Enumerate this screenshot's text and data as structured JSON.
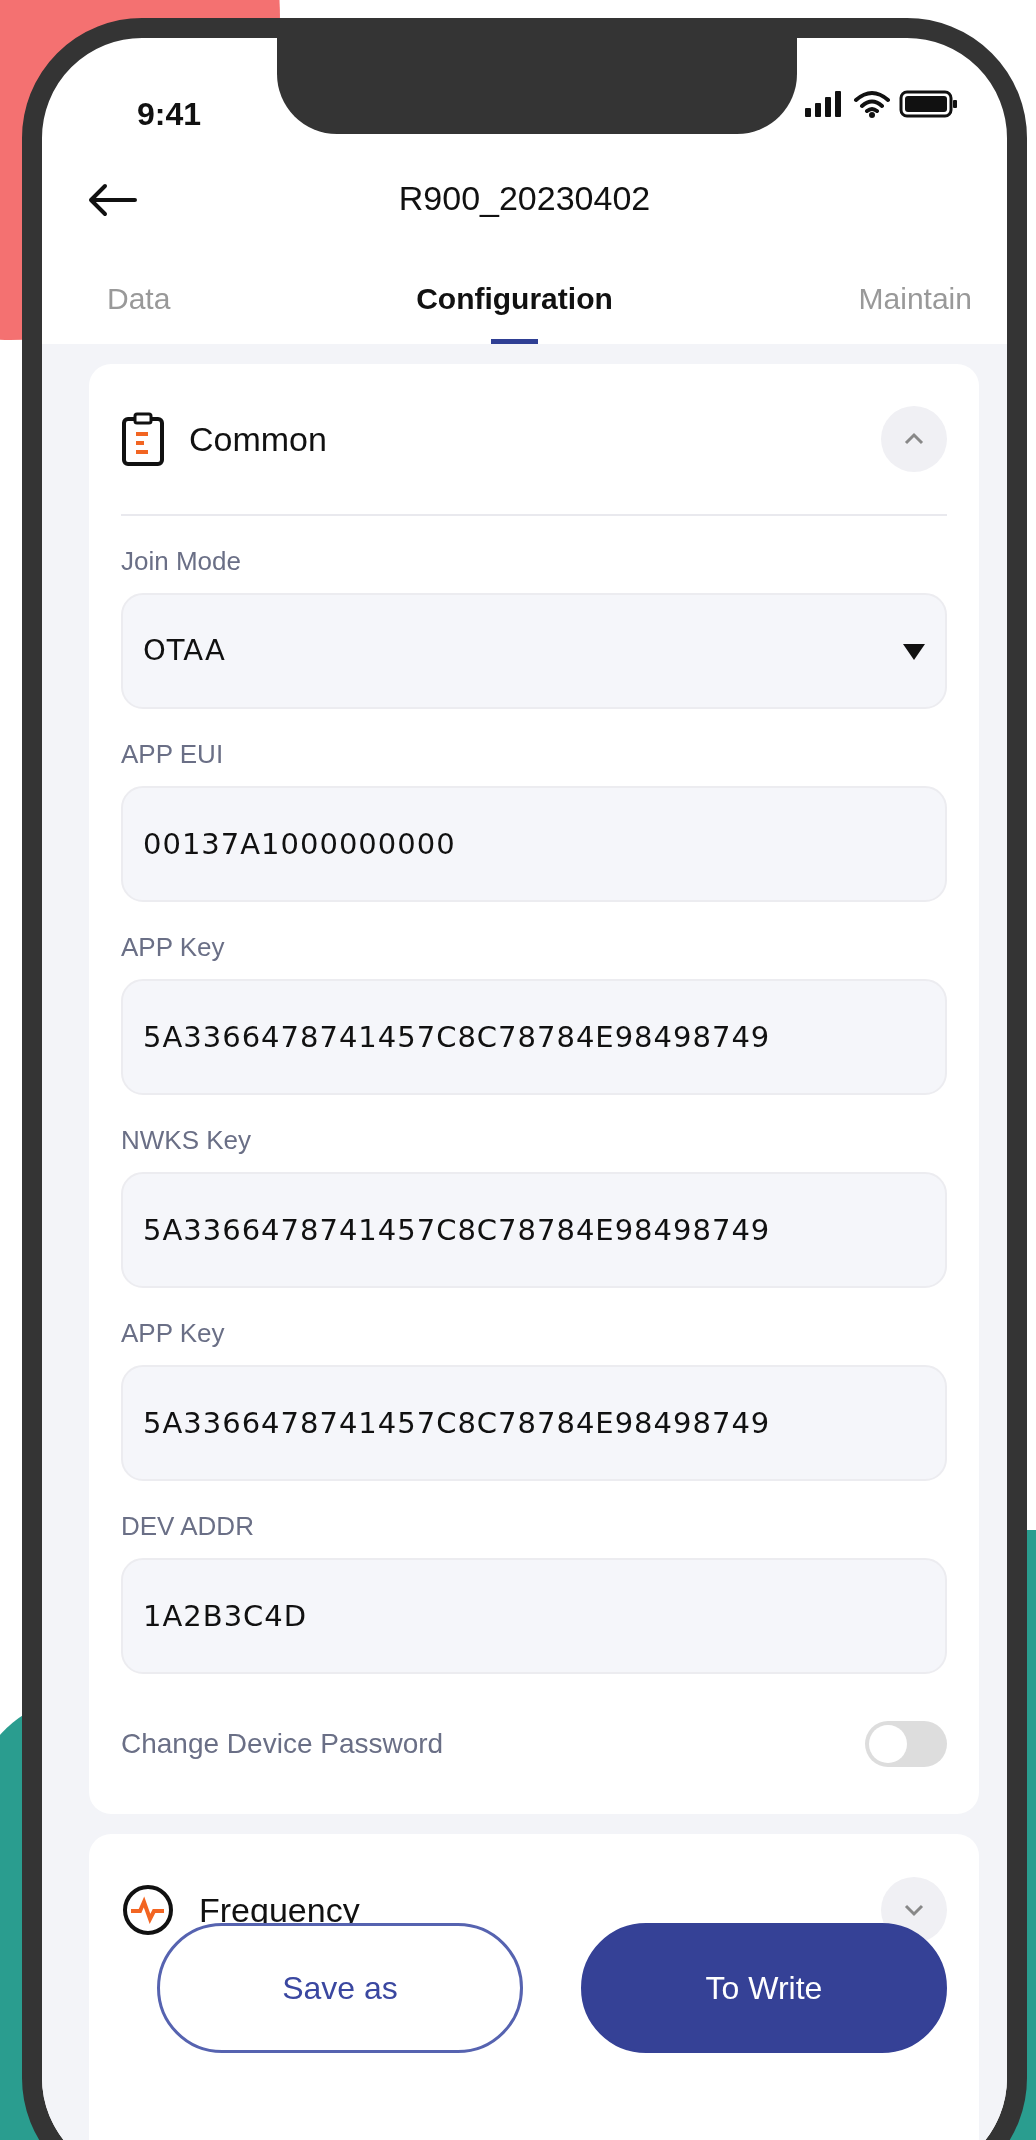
{
  "status_bar": {
    "time": "9:41"
  },
  "header": {
    "title": "R900_20230402"
  },
  "tabs": [
    {
      "label": "Data",
      "selected": false
    },
    {
      "label": "Configuration",
      "selected": true
    },
    {
      "label": "Maintain",
      "selected": false
    }
  ],
  "sections": [
    {
      "title": "Common",
      "expanded": true,
      "fields": [
        {
          "kind": "select",
          "label": "Join Mode",
          "value": "OTAA"
        },
        {
          "kind": "text",
          "label": "APP EUI",
          "value": "00137A1000000000"
        },
        {
          "kind": "text",
          "label": "APP Key",
          "value": "5A3366478741457C8C78784E98498749"
        },
        {
          "kind": "text",
          "label": "NWKS Key",
          "value": "5A3366478741457C8C78784E98498749"
        },
        {
          "kind": "text",
          "label": "APP Key",
          "value": "5A3366478741457C8C78784E98498749"
        },
        {
          "kind": "text",
          "label": "DEV ADDR",
          "value": "1A2B3C4D"
        }
      ],
      "toggle": {
        "label": "Change Device Password",
        "on": false
      }
    },
    {
      "title": "Frequency",
      "expanded": false
    }
  ],
  "actions": [
    {
      "label": "Save as",
      "kind": "secondary"
    },
    {
      "label": "To Write",
      "kind": "primary"
    }
  ]
}
